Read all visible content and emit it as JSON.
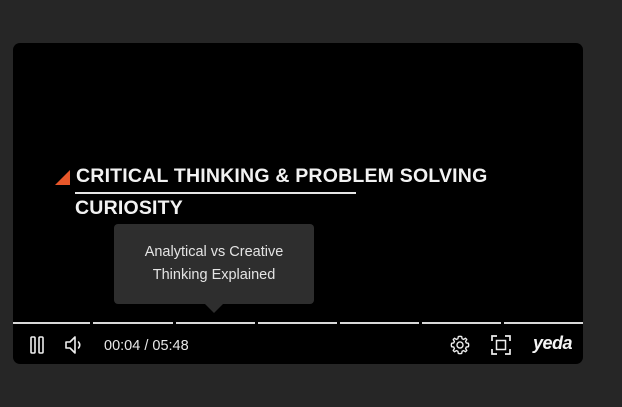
{
  "slide": {
    "title_line1": "CRITICAL THINKING & PROBLEM SOLVING",
    "title_line2": "CURIOSITY",
    "accent_color": "#e8572a"
  },
  "tooltip": {
    "line1": "Analytical vs Creative",
    "line2": "Thinking Explained"
  },
  "progress": {
    "chapter_count": 7,
    "current_time": "00:04",
    "separator": "/",
    "duration": "05:48"
  },
  "controls": {
    "play_state": "playing",
    "icons": [
      "pause-icon",
      "volume-icon",
      "settings-gear-icon",
      "fullscreen-icon"
    ]
  },
  "brand": {
    "logo_text": "yeda"
  }
}
